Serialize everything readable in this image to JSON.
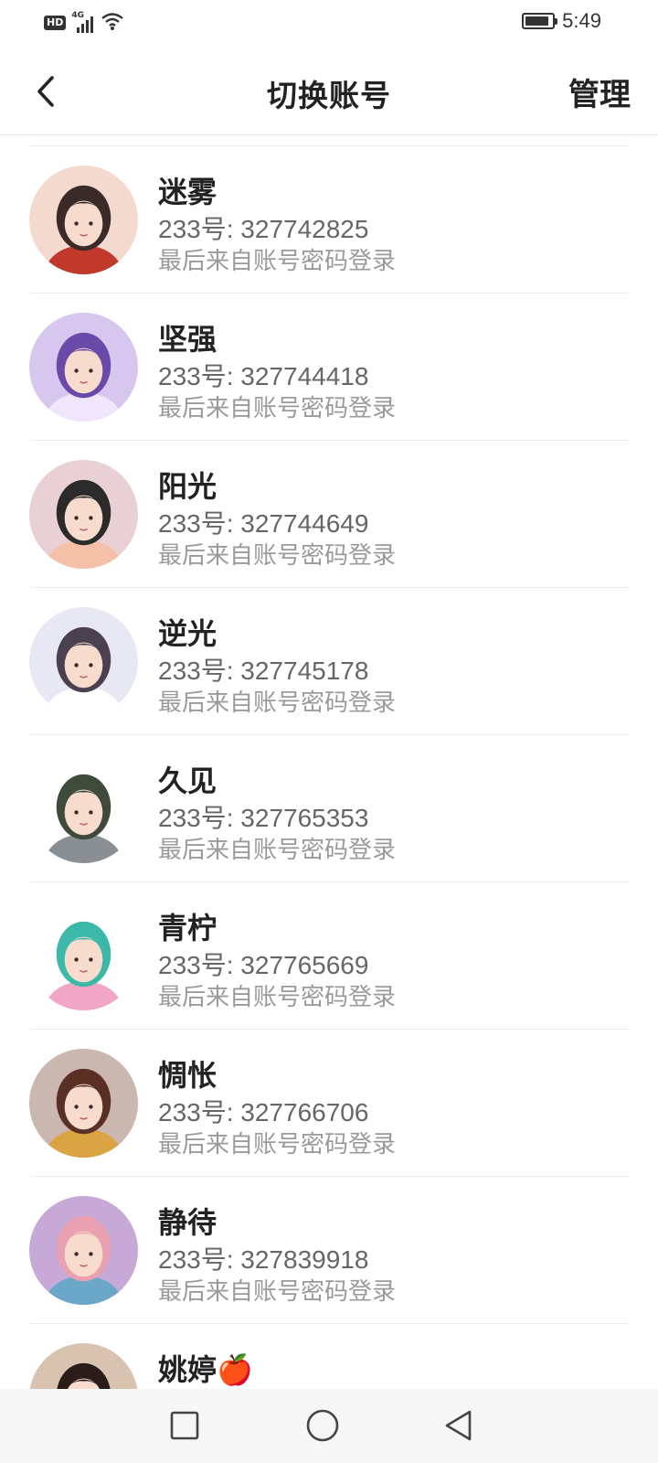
{
  "status_bar": {
    "network_badge": "HD",
    "signal_type": "4G",
    "time": "5:49",
    "battery_level": 0.9,
    "icons": [
      "hd-badge",
      "signal-icon",
      "wifi-icon",
      "battery-icon"
    ]
  },
  "header": {
    "title": "切换账号",
    "manage_label": "管理",
    "back_icon": "chevron-left-icon"
  },
  "accounts": [
    {
      "name": "迷雾",
      "id_text": "233号: 327742825",
      "login_note": "最后来自账号密码登录",
      "avatar_colors": [
        "#f4d9cf",
        "#3a2a28",
        "#c0392b"
      ]
    },
    {
      "name": "坚强",
      "id_text": "233号: 327744418",
      "login_note": "最后来自账号密码登录",
      "avatar_colors": [
        "#d7c7ef",
        "#6a4aa8",
        "#f0e6fb"
      ]
    },
    {
      "name": "阳光",
      "id_text": "233号: 327744649",
      "login_note": "最后来自账号密码登录",
      "avatar_colors": [
        "#e9d0d4",
        "#2b2b2b",
        "#f4c1a8"
      ]
    },
    {
      "name": "逆光",
      "id_text": "233号: 327745178",
      "login_note": "最后来自账号密码登录",
      "avatar_colors": [
        "#e8e8f4",
        "#4a4050",
        "#ffffff"
      ]
    },
    {
      "name": "久见",
      "id_text": "233号: 327765353",
      "login_note": "最后来自账号密码登录",
      "avatar_colors": [
        "#ffffff",
        "#3e4a3a",
        "#8a8f93"
      ]
    },
    {
      "name": "青柠",
      "id_text": "233号: 327765669",
      "login_note": "最后来自账号密码登录",
      "avatar_colors": [
        "#ffffff",
        "#3bb8a8",
        "#f2a6c6"
      ]
    },
    {
      "name": "惆怅",
      "id_text": "233号: 327766706",
      "login_note": "最后来自账号密码登录",
      "avatar_colors": [
        "#c9b7b0",
        "#5a3024",
        "#d9a441"
      ]
    },
    {
      "name": "静待",
      "id_text": "233号: 327839918",
      "login_note": "最后来自账号密码登录",
      "avatar_colors": [
        "#c7a9d8",
        "#e9a0b0",
        "#6aa7c9"
      ]
    },
    {
      "name": "姚婷🍎",
      "id_text": "",
      "login_note": "",
      "avatar_colors": [
        "#d8c2b0",
        "#2a1c18",
        "#f0e2d8"
      ]
    }
  ],
  "system_nav": {
    "items": [
      "recent-apps-icon",
      "home-icon",
      "back-triangle-icon"
    ]
  }
}
